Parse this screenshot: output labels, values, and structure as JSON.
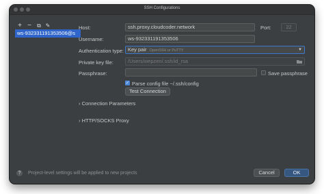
{
  "window": {
    "title": "SSH Configurations"
  },
  "toolbar": {
    "add": "+",
    "remove": "−",
    "copy": "⧉",
    "edit": "✎"
  },
  "configs": [
    {
      "label": "ws-932331191353506@s"
    }
  ],
  "form": {
    "host_label": "Host:",
    "host_value": "ssh.proxy.cloudcoder.network",
    "port_label": "Port:",
    "port_value": "22",
    "username_label": "Username:",
    "username_value": "ws-932331191353506",
    "auth_label": "Authentication type:",
    "auth_value": "Key pair",
    "auth_hint": "OpenSSH or PuTTY",
    "keyfile_label": "Private key file:",
    "keyfile_value": "/Users/wepzen/.ssh/id_rsa",
    "passphrase_label": "Passphrase:",
    "passphrase_value": "",
    "save_passphrase_label": "Save passphrase",
    "save_passphrase_checked": false,
    "parse_config_label": "Parse config file ~/.ssh/config",
    "parse_config_checked": true,
    "test_connection_label": "Test Connection"
  },
  "sections": {
    "connection_parameters": "Connection Parameters",
    "proxy": "HTTP/SOCKS Proxy"
  },
  "footer": {
    "help": "?",
    "note": "Project-level settings will be applied to new projects",
    "cancel_label": "Cancel",
    "ok_label": "OK"
  },
  "colors": {
    "window_bg": "#3c3f41",
    "selection": "#2f65ca",
    "primary_button": "#365880"
  }
}
